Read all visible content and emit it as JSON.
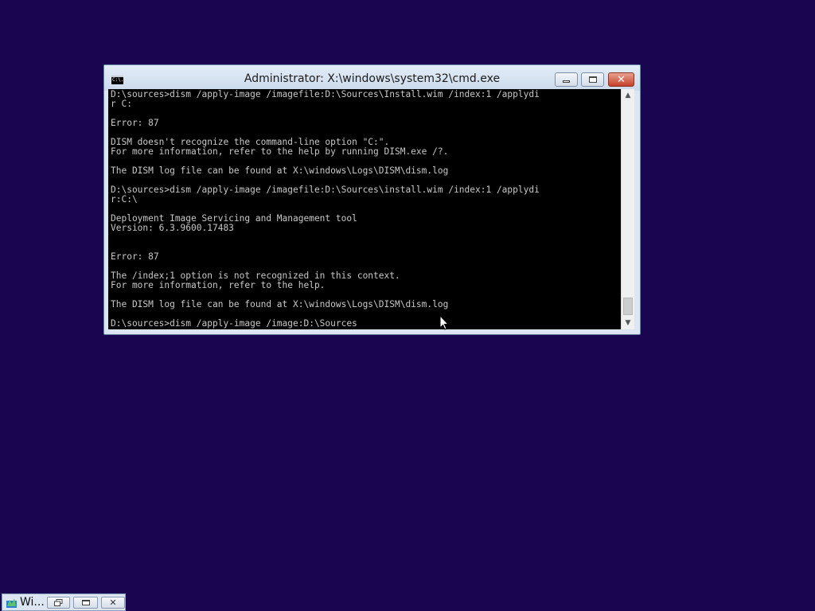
{
  "window": {
    "title": "Administrator: X:\\windows\\system32\\cmd.exe",
    "icon": "cmd-icon",
    "icon_text": "C:\\."
  },
  "console": {
    "lines": [
      "D:\\sources>dism /apply-image /imagefile:D:\\Sources\\Install.wim /index:1 /applydi",
      "r C:",
      "",
      "Error: 87",
      "",
      "DISM doesn't recognize the command-line option \"C:\".",
      "For more information, refer to the help by running DISM.exe /?.",
      "",
      "The DISM log file can be found at X:\\windows\\Logs\\DISM\\dism.log",
      "",
      "D:\\sources>dism /apply-image /imagefile:D:\\Sources\\install.wim /index:1 /applydi",
      "r:C:\\",
      "",
      "Deployment Image Servicing and Management tool",
      "Version: 6.3.9600.17483",
      "",
      "",
      "Error: 87",
      "",
      "The /index;1 option is not recognized in this context.",
      "For more information, refer to the help.",
      "",
      "The DISM log file can be found at X:\\windows\\Logs\\DISM\\dism.log",
      "",
      "D:\\sources>dism /apply-image /image:D:\\Sources"
    ]
  },
  "taskbar": {
    "label": "Wi...",
    "icon": "setup-icon"
  },
  "colors": {
    "desktop": "#1a0650",
    "console_bg": "#000000",
    "console_text": "#c8c8c8",
    "frame": "#dbe6f2",
    "close_button": "#c7402a"
  }
}
